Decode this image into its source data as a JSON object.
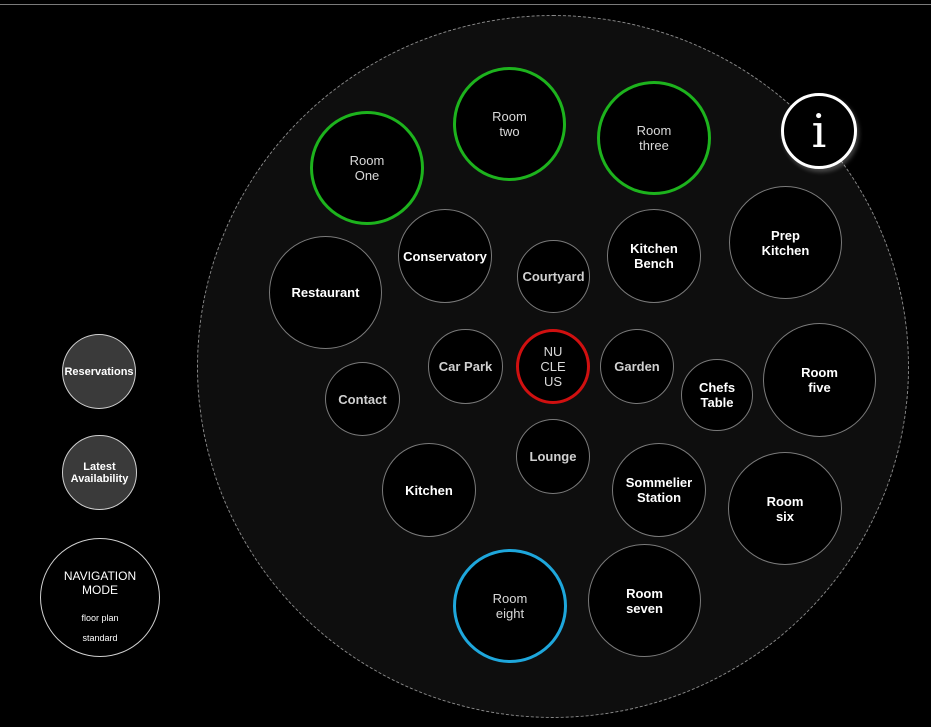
{
  "nodes": {
    "room_one": "Room\nOne",
    "room_two": "Room\ntwo",
    "room_three": "Room\nthree",
    "prep_kitchen": "Prep\nKitchen",
    "restaurant": "Restaurant",
    "conservatory": "Conservatory",
    "courtyard": "Courtyard",
    "kitchen_bench": "Kitchen\nBench",
    "car_park": "Car Park",
    "nucleus": "NU\nCLE\nUS",
    "garden": "Garden",
    "chefs_table": "Chefs\nTable",
    "room_five": "Room\nfive",
    "contact": "Contact",
    "lounge": "Lounge",
    "kitchen": "Kitchen",
    "sommelier_station": "Sommelier\nStation",
    "room_six": "Room\nsix",
    "room_eight": "Room\neight",
    "room_seven": "Room\nseven"
  },
  "info_button": "i",
  "sidebar": {
    "reservations": "Reservations",
    "latest_availability": "Latest\nAvailability",
    "navigation_mode": {
      "title": "NAVIGATION\nMODE",
      "options": [
        "floor plan",
        "standard"
      ]
    }
  },
  "colors": {
    "room_ring": "#1db31d",
    "room_eight_ring": "#1ea7dc",
    "nucleus_ring": "#d01010",
    "background": "#000000",
    "plate": "#0e0e0e"
  }
}
